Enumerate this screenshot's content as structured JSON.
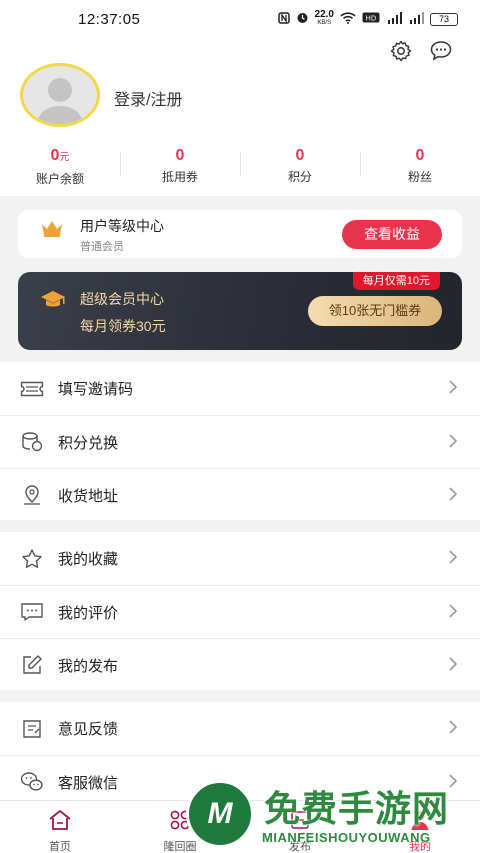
{
  "status_bar": {
    "time": "12:37:05",
    "net_speed": "22.0",
    "net_unit": "KB/S",
    "battery": "73"
  },
  "profile": {
    "login_label": "登录/注册",
    "stats": [
      {
        "value": "0",
        "unit": "元",
        "label": "账户余额"
      },
      {
        "value": "0",
        "unit": "",
        "label": "抵用券"
      },
      {
        "value": "0",
        "unit": "",
        "label": "积分"
      },
      {
        "value": "0",
        "unit": "",
        "label": "粉丝"
      }
    ]
  },
  "level_card": {
    "title": "用户等级中心",
    "subtitle": "普通会员",
    "button": "查看收益"
  },
  "vip_card": {
    "title": "超级会员中心",
    "subtitle": "每月领券30元",
    "tag": "每月仅需10元",
    "button": "领10张无门槛券"
  },
  "menu_groups": [
    [
      {
        "label": "填写邀请码",
        "icon": "ticket-icon"
      },
      {
        "label": "积分兑换",
        "icon": "coins-icon"
      },
      {
        "label": "收货地址",
        "icon": "location-icon"
      }
    ],
    [
      {
        "label": "我的收藏",
        "icon": "star-icon"
      },
      {
        "label": "我的评价",
        "icon": "comment-icon"
      },
      {
        "label": "我的发布",
        "icon": "edit-icon"
      }
    ],
    [
      {
        "label": "意见反馈",
        "icon": "feedback-icon"
      },
      {
        "label": "客服微信",
        "icon": "wechat-icon"
      }
    ]
  ],
  "tabbar": [
    {
      "label": "首页",
      "icon": "home-icon"
    },
    {
      "label": "隆回圈",
      "icon": "grid-icon"
    },
    {
      "label": "发布",
      "icon": "publish-icon"
    },
    {
      "label": "我的",
      "icon": "profile-icon"
    }
  ],
  "watermark": {
    "title": "免费手游网",
    "subtitle": "MIANFEISHOUYOUWANG",
    "logo_letter": "M"
  },
  "colors": {
    "accent": "#e9334c",
    "vip_gold": "#f3d7a6",
    "avatar_ring": "#f3d84a",
    "watermark_green": "#2d8a3f"
  }
}
